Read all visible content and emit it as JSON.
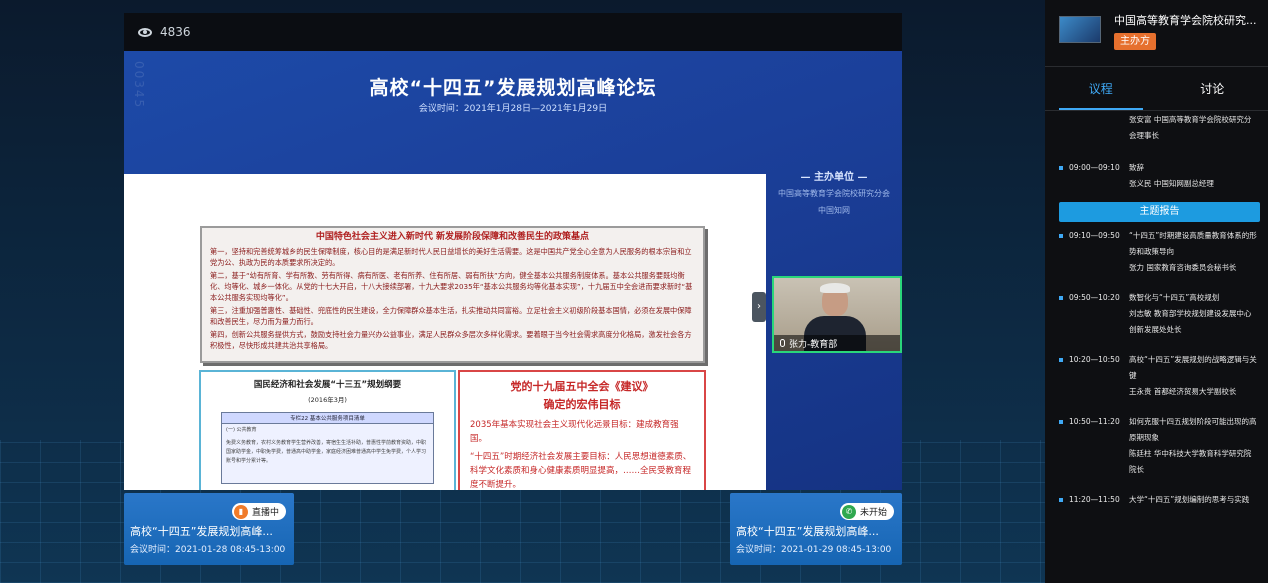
{
  "player": {
    "view_count": "4836",
    "slide": {
      "title": "高校“十四五”发展规划高峰论坛",
      "date": "会议时间：2021年1月28日—2021年1月29日",
      "side_text": "00345",
      "organizer_heading": "— 主办单位 —",
      "organizer_1": "中国高等教育学会院校研究分会",
      "organizer_2": "中国知网",
      "box1_title": "中国特色社会主义进入新时代  新发展阶段保障和改善民生的政策基点",
      "box1_p1": "第一，坚持和完善统筹城乡的民生保障制度，核心目的是满足新时代人民日益增长的美好生活需要。这是中国共产党全心全意为人民服务的根本宗旨和立党为公、执政为民的本质要求所决定的。",
      "box1_p2": "第二，基于“幼有所育、学有所教、劳有所得、病有所医、老有所养、住有所居、弱有所扶”方向，健全基本公共服务制度体系。基本公共服务要既均衡化、均等化、城乡一体化。从党的十七大开启，十八大接续部署，十九大要求2035年“基本公共服务均等化基本实现”，十九届五中全会进而要求新时“基本公共服务实现均等化”。",
      "box1_p3": "第三，注重加强普惠性、基础性、兜底性的民生建设，全力保障群众基本生活，扎实推动共同富裕。立足社会主义初级阶段基本国情，必须在发展中保障和改善民生，尽力而为量力而行。",
      "box1_p4": "第四，创新公共服务提供方式，鼓励支持社会力量兴办公益事业，满足人民群众多层次多样化需求。要着眼于当今社会需求高度分化格局，激发社会各方积极性，尽快形成共建共治共享格局。",
      "box2_title": "国民经济和社会发展“十三五”规划纲要",
      "box2_date": "(2016年3月)",
      "box2_table_header": "专栏22  基本公共服务项目清单",
      "box2_table_sub": "(一) 公共教育",
      "box2_table_text": "免费义务教育，农村义务教育学生营养改善，寄宿生生活补助，普惠性学前教育资助，中职国家助学金，中职免学费，普通高中助学金，家庭经济困难普通高中学生免学费，个人学习账号和学分累计等。",
      "box3_title1": "党的十九届五中全会《建议》",
      "box3_title2": "确定的宏伟目标",
      "box3_p1": "2035年基本实现社会主义现代化远景目标：建成教育强国。",
      "box3_p2": "“十四五”时期经济社会发展主要目标：人民思想道德素质、科学文化素质和身心健康素质明显提高，……全民受教育程度不断提升。"
    },
    "pip_label": "张力-教育部"
  },
  "sessions": [
    {
      "status": "直播中",
      "title": "高校“十四五”发展规划高峰...",
      "time": "会议时间：2021-01-28 08:45-13:00"
    },
    {
      "status": "未开始",
      "title": "高校“十四五”发展规划高峰...",
      "time": "会议时间：2021-01-29 08:45-13:00"
    }
  ],
  "sidebar": {
    "org_name": "中国高等教育学会院校研究...",
    "org_tag": "主办方",
    "tabs": [
      "议程",
      "讨论"
    ],
    "agenda_top_sub": "张安富 中国高等教育学会院校研究分会理事长",
    "items": [
      {
        "time": "09:00—09:10",
        "title": "致辞",
        "speaker": "张义民 中国知网副总经理"
      }
    ],
    "section": "主题报告",
    "reports": [
      {
        "time": "09:10—09:50",
        "title": "“十四五”时期建设高质量教育体系的形势和政策导向",
        "speaker": "张力 国家教育咨询委员会秘书长"
      },
      {
        "time": "09:50—10:20",
        "title": "数智化与“十四五”高校规划",
        "speaker": "刘志敏 教育部学校规划建设发展中心创新发展处处长"
      },
      {
        "time": "10:20—10:50",
        "title": "高校“十四五”发展规划的战略逻辑与关键",
        "speaker": "王永贵 首都经济贸易大学副校长"
      },
      {
        "time": "10:50—11:20",
        "title": "如何克服十四五规划阶段可能出现的高原期现象",
        "speaker": "陈廷柱 华中科技大学教育科学研究院院长"
      },
      {
        "time": "11:20—11:50",
        "title": "大学“十四五”规划编制的思考与实践",
        "speaker": ""
      }
    ]
  }
}
